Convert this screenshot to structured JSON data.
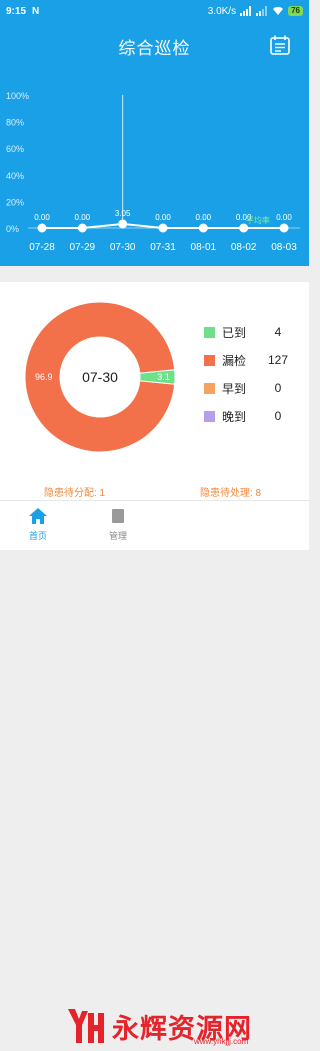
{
  "status_bar": {
    "time": "9:15",
    "notification": "N",
    "network_speed": "3.0K/s",
    "battery": "76"
  },
  "header": {
    "title": "综合巡检",
    "calendar_icon": "calendar-icon"
  },
  "chart_data": [
    {
      "type": "line",
      "categories": [
        "07-28",
        "07-29",
        "07-30",
        "07-31",
        "08-01",
        "08-02",
        "08-03"
      ],
      "series": [
        {
          "name": "平均率",
          "values": [
            0.0,
            0.0,
            3.05,
            0.0,
            0.0,
            0.0,
            0.0
          ]
        }
      ],
      "data_labels": [
        "0.00",
        "0.00",
        "3.05",
        "0.00",
        "0.00",
        "0.00",
        "0.00"
      ],
      "y_ticks": [
        "0%",
        "20%",
        "40%",
        "60%",
        "80%",
        "100%"
      ],
      "ylim": [
        0,
        100
      ],
      "highlight_category": "07-30",
      "grid": false,
      "legend_label": "平均率",
      "colors": {
        "line": "#ffffff",
        "background": "#1aa0e6"
      }
    },
    {
      "type": "pie",
      "center_label": "07-30",
      "slices": [
        {
          "name": "漏检",
          "value": 96.9,
          "label": "96.9",
          "color": "#f2704a"
        },
        {
          "name": "已到",
          "value": 3.1,
          "label": "3.1",
          "color": "#6ee08a"
        }
      ]
    }
  ],
  "legend": [
    {
      "label": "已到",
      "value": "4",
      "color": "#6ee08a"
    },
    {
      "label": "漏检",
      "value": "127",
      "color": "#f2704a"
    },
    {
      "label": "早到",
      "value": "0",
      "color": "#f4a460"
    },
    {
      "label": "晚到",
      "value": "0",
      "color": "#b79ee8"
    }
  ],
  "bottom_strip": {
    "pending_assign": "隐患待分配: 1",
    "pending_handle": "隐患待处理: 8"
  },
  "nav": {
    "home_label": "首页",
    "manage_label": "管理",
    "watermark_text": "永辉资源网",
    "watermark_url": "www.yhkjjj.com"
  }
}
